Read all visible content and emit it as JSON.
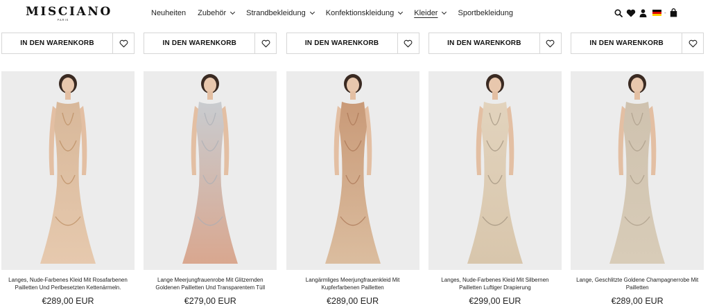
{
  "brand": {
    "name": "MISCIANO",
    "sub": "PARIS"
  },
  "nav": [
    {
      "label": "Neuheiten",
      "has_dropdown": false
    },
    {
      "label": "Zubehör",
      "has_dropdown": true
    },
    {
      "label": "Strandbekleidung",
      "has_dropdown": true
    },
    {
      "label": "Konfektionskleidung",
      "has_dropdown": true
    },
    {
      "label": "Kleider",
      "has_dropdown": true,
      "active": true
    },
    {
      "label": "Sportbekleidung",
      "has_dropdown": false
    }
  ],
  "header_icons": [
    "search-icon",
    "heart-icon",
    "user-icon",
    "german-flag-icon",
    "cart-icon"
  ],
  "flag_colors": [
    "#000000",
    "#dd0000",
    "#ffce00"
  ],
  "cart_label": "IN DEN WARENKORB",
  "products": [
    {
      "name": "Langes, Nude-Farbenes Kleid Mit Rosafarbenen Pailletten Und Perlbesetzten Kettenärmeln.",
      "price": "€289,00 EUR",
      "colors": {
        "top": "#d8b89a",
        "bottom": "#e6c9ae",
        "accent": "#b98a5e"
      }
    },
    {
      "name": "Lange Meerjungfrauenrobe Mit Glitzernden Goldenen Pailletten Und Transparentem Tüll",
      "price": "€279,00 EUR",
      "colors": {
        "top": "#c9ccd0",
        "bottom": "#d9a78f",
        "accent": "#a9aeb5"
      }
    },
    {
      "name": "Langärmliges Meerjungfrauenkleid Mit Kupferfarbenen Pailletten",
      "price": "€289,00 EUR",
      "colors": {
        "top": "#c99a78",
        "bottom": "#dbbd9f",
        "accent": "#a87452"
      }
    },
    {
      "name": "Langes, Nude-Farbenes Kleid Mit Silbernen Pailletten Luftiger Drapierung",
      "price": "€299,00 EUR",
      "colors": {
        "top": "#e2d3bd",
        "bottom": "#d8c6ac",
        "accent": "#9c8e7a"
      }
    },
    {
      "name": "Lange, Geschlitzte Goldene Champagnerrobe Mit Pailletten",
      "price": "€289,00 EUR",
      "colors": {
        "top": "#cfc2af",
        "bottom": "#d8ccb8",
        "accent": "#a89a86"
      }
    }
  ]
}
